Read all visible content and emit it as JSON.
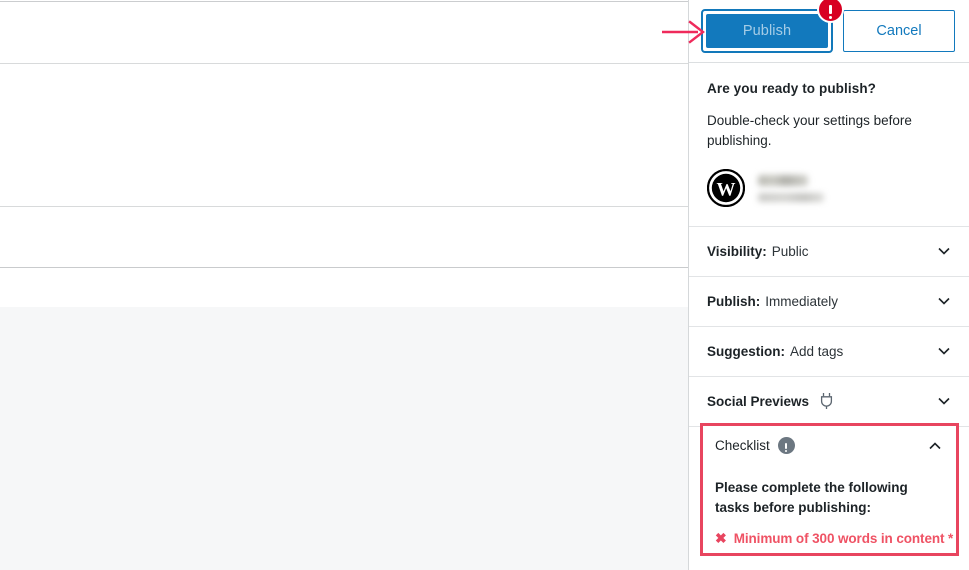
{
  "editor": {
    "canvas_note": "blank post editor canvas with section rules and grey block"
  },
  "annotation": {
    "arrow_color": "#ef2a5b",
    "arrow_name": "pointer-arrow-to-publish"
  },
  "panel": {
    "header": {
      "publish_label": "Publish",
      "cancel_label": "Cancel",
      "alert_badge_color": "#d80022",
      "publish_button_color": "#1279bd"
    },
    "intro": {
      "heading": "Are you ready to publish?",
      "body": "Double-check your settings before publishing.",
      "site_icon": "wordpress-logo-icon",
      "site_name": "",
      "site_url": ""
    },
    "settings": [
      {
        "key": "Visibility:",
        "value": "Public",
        "icon": "",
        "chevron": "chevron-down-icon"
      },
      {
        "key": "Publish:",
        "value": "Immediately",
        "icon": "",
        "chevron": "chevron-down-icon"
      },
      {
        "key": "Suggestion:",
        "value": "Add tags",
        "icon": "",
        "chevron": "chevron-down-icon"
      },
      {
        "key": "Social Previews",
        "value": "",
        "icon": "plug-icon",
        "chevron": "chevron-down-icon"
      }
    ],
    "checklist": {
      "title": "Checklist",
      "info_icon": "info-exclamation-icon",
      "toggle_icon": "chevron-up-icon",
      "instruction": "Please complete the following tasks before publishing:",
      "tasks": [
        {
          "icon": "x-mark-icon",
          "text": "Minimum of 300 words in content *"
        }
      ],
      "border_color": "#e8455f",
      "task_text_color": "#ef5264"
    }
  }
}
